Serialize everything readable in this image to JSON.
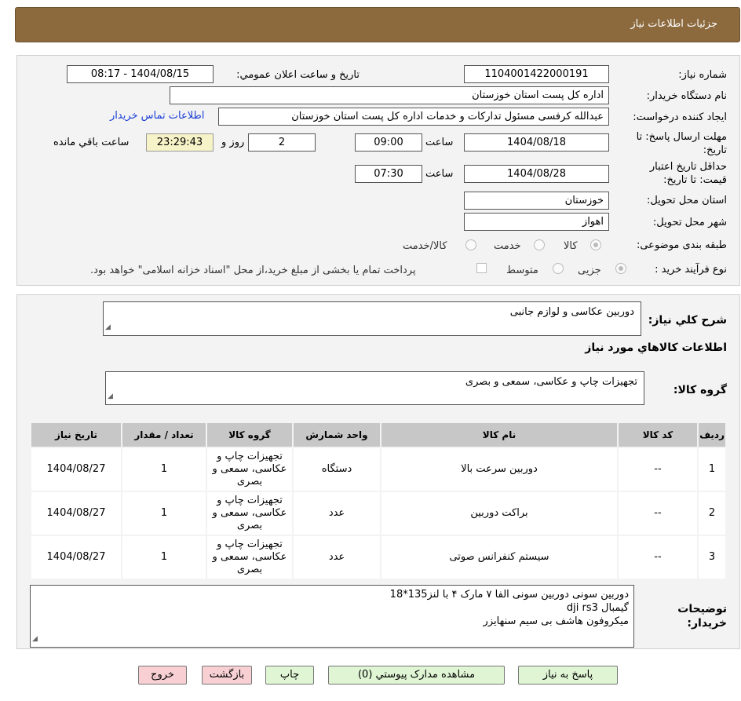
{
  "header": {
    "title": "جزئیات اطلاعات نیاز"
  },
  "watermark": {
    "text": "AriaTender.neT"
  },
  "form": {
    "need_number_label": "شماره نیاز:",
    "need_number": "1104001422000191",
    "announce_label": "تاریخ و ساعت اعلان عمومي:",
    "announce_value": "1404/08/15 - 08:17",
    "buyer_org_label": "نام دستگاه خریدار:",
    "buyer_org": "اداره کل پست استان خوزستان",
    "creator_label": "ایجاد کننده درخواست:",
    "creator": "عبدالله کرفسی مسئول تداركات و خدمات اداره كل پست استان خوزستان",
    "contact_link": "اطلاعات تماس خریدار",
    "deadline_label_1": "مهلت ارسال پاسخ: تا",
    "deadline_label_2": "تاریخ:",
    "deadline_date": "1404/08/18",
    "time_label": "ساعت",
    "deadline_time": "09:00",
    "days_value": "2",
    "days_label": "روز و",
    "remaining_time": "23:29:43",
    "remaining_label": "ساعت باقي مانده",
    "validity_label_1": "حداقل تاریخ اعتبار",
    "validity_label_2": "قیمت: تا تاریخ:",
    "validity_date": "1404/08/28",
    "validity_time": "07:30",
    "province_label": "استان محل تحویل:",
    "province": "خوزستان",
    "city_label": "شهر محل تحویل:",
    "city": "اهواز",
    "category_label": "طبقه بندی موضوعی:",
    "category_options": [
      "کالا",
      "خدمت",
      "کالا/خدمت"
    ],
    "process_label": "نوع فرآیند خرید :",
    "process_options": [
      "جزیی",
      "متوسط"
    ],
    "payment_note": "پرداخت تمام یا بخشی از مبلغ خرید،از محل \"اسناد خزانه اسلامی\" خواهد بود."
  },
  "details": {
    "summary_label": "شرح کلي نیاز:",
    "summary": "دوربین عکاسی و لوازم جانبی",
    "goods_info_title": "اطلاعات کالاهاي مورد نیاز",
    "goods_group_label": "گروه کالا:",
    "goods_group": "تجهیزات چاپ و عکاسی، سمعی و بصری",
    "table": {
      "headers": [
        "ردیف",
        "کد کالا",
        "نام کالا",
        "واحد شمارش",
        "گروه کالا",
        "تعداد / مقدار",
        "تاریخ نیاز"
      ],
      "rows": [
        [
          "1",
          "--",
          "دوربین سرعت بالا",
          "دستگاه",
          "تجهیزات چاپ و عکاسی، سمعی و بصری",
          "1",
          "1404/08/27"
        ],
        [
          "2",
          "--",
          "براکت دوربین",
          "عدد",
          "تجهیزات چاپ و عکاسی، سمعی و بصری",
          "1",
          "1404/08/27"
        ],
        [
          "3",
          "--",
          "سیستم کنفرانس صوتی",
          "عدد",
          "تجهیزات چاپ و عکاسی، سمعی و بصری",
          "1",
          "1404/08/27"
        ]
      ]
    },
    "buyer_notes_label_1": "توضیحات",
    "buyer_notes_label_2": "خریدار:",
    "buyer_notes": [
      "دوربین سونی دوربین سونی الفا ۷ مارک ۴ با لنز135*18",
      "گیمبال dji rs3",
      "میکروفون هاشف بی سیم سنهایزر"
    ]
  },
  "buttons": {
    "reply": "پاسخ به نیاز",
    "attachments": "مشاهده مدارک پیوستي (0)",
    "print": "چاپ",
    "back": "بازگشت",
    "exit": "خروج"
  },
  "colors": {
    "header_bg": "#8c6a3e",
    "link": "#1a3fd6",
    "timer_bg": "#f7f3c8"
  }
}
